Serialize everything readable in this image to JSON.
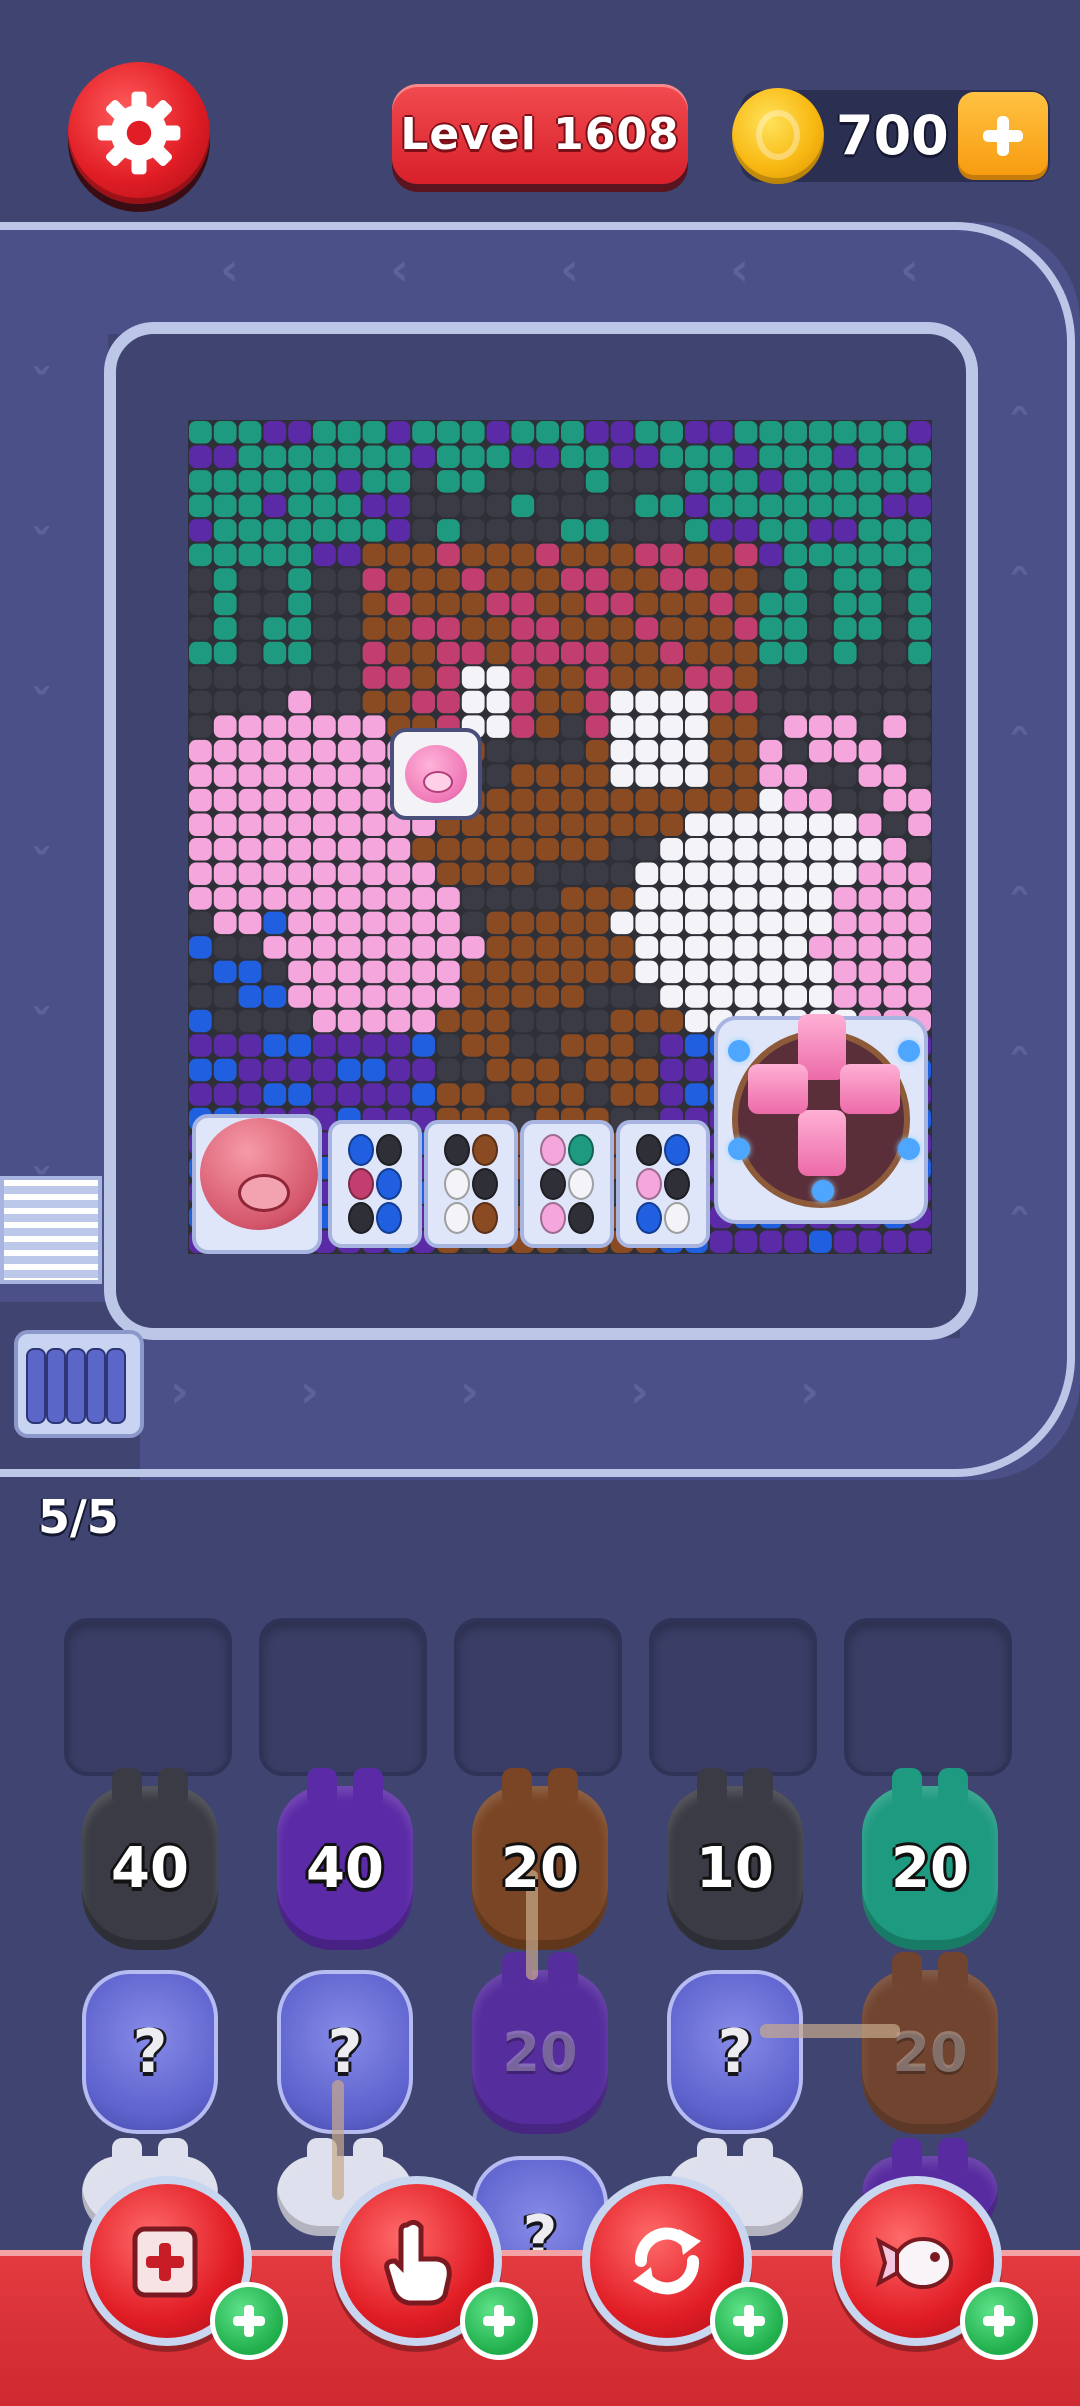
{
  "header": {
    "level_label": "Level 1608",
    "coins": "700",
    "settings_icon": "gear-icon",
    "coin_icon": "coin-icon",
    "add_coins_icon": "plus-icon"
  },
  "queue": {
    "count_label": "5/5"
  },
  "colors": {
    "teal": "#1e9a80",
    "dark": "#3a3b44",
    "purple": "#5b2aa6",
    "brown": "#8a4a22",
    "rose": "#c23e6e",
    "pink": "#f4a6dd",
    "white": "#f4f4f8",
    "blue": "#1f5fe0"
  },
  "trays": [
    {
      "beans": [
        "#1f5fe0",
        "#2e2f37",
        "#c23e6e",
        "#1f5fe0",
        "#2e2f37",
        "#1f5fe0"
      ]
    },
    {
      "beans": [
        "#2e2f37",
        "#8a4a22",
        "#f4f4f8",
        "#2e2f37",
        "#f4f4f8",
        "#8a4a22"
      ]
    },
    {
      "beans": [
        "#f4a6dd",
        "#1e9a80",
        "#2e2f37",
        "#f4f4f8",
        "#f4a6dd",
        "#2e2f37"
      ]
    },
    {
      "beans": [
        "#2e2f37",
        "#1f5fe0",
        "#f4a6dd",
        "#2e2f37",
        "#1f5fe0",
        "#f4f4f8"
      ]
    }
  ],
  "slots": [
    "",
    "",
    "",
    "",
    ""
  ],
  "piggy_rows": [
    [
      {
        "value": "40",
        "color": "#3a3b44"
      },
      {
        "value": "40",
        "color": "#5b2aa6"
      },
      {
        "value": "20",
        "color": "#7a4524"
      },
      {
        "value": "10",
        "color": "#3a3b44"
      },
      {
        "value": "20",
        "color": "#1e9a80"
      }
    ],
    [
      {
        "value": "?",
        "type": "mystery"
      },
      {
        "value": "?",
        "type": "mystery"
      },
      {
        "value": "20",
        "type": "dim",
        "color": "#5b2aa6"
      },
      {
        "value": "?",
        "type": "mystery"
      },
      {
        "value": "20",
        "type": "dim",
        "color": "#7a4524"
      }
    ],
    [
      {
        "value": "",
        "type": "white"
      },
      {
        "value": "",
        "type": "white"
      },
      {
        "value": "?",
        "type": "mystery"
      },
      {
        "value": "",
        "type": "white"
      },
      {
        "value": "",
        "type": "purple"
      }
    ]
  ],
  "boosters": [
    {
      "name": "add-slot",
      "icon": "add-box-icon"
    },
    {
      "name": "tap-pick",
      "icon": "hand-pointer-icon"
    },
    {
      "name": "shuffle",
      "icon": "refresh-icon"
    },
    {
      "name": "rocket",
      "icon": "pig-rocket-icon"
    }
  ]
}
